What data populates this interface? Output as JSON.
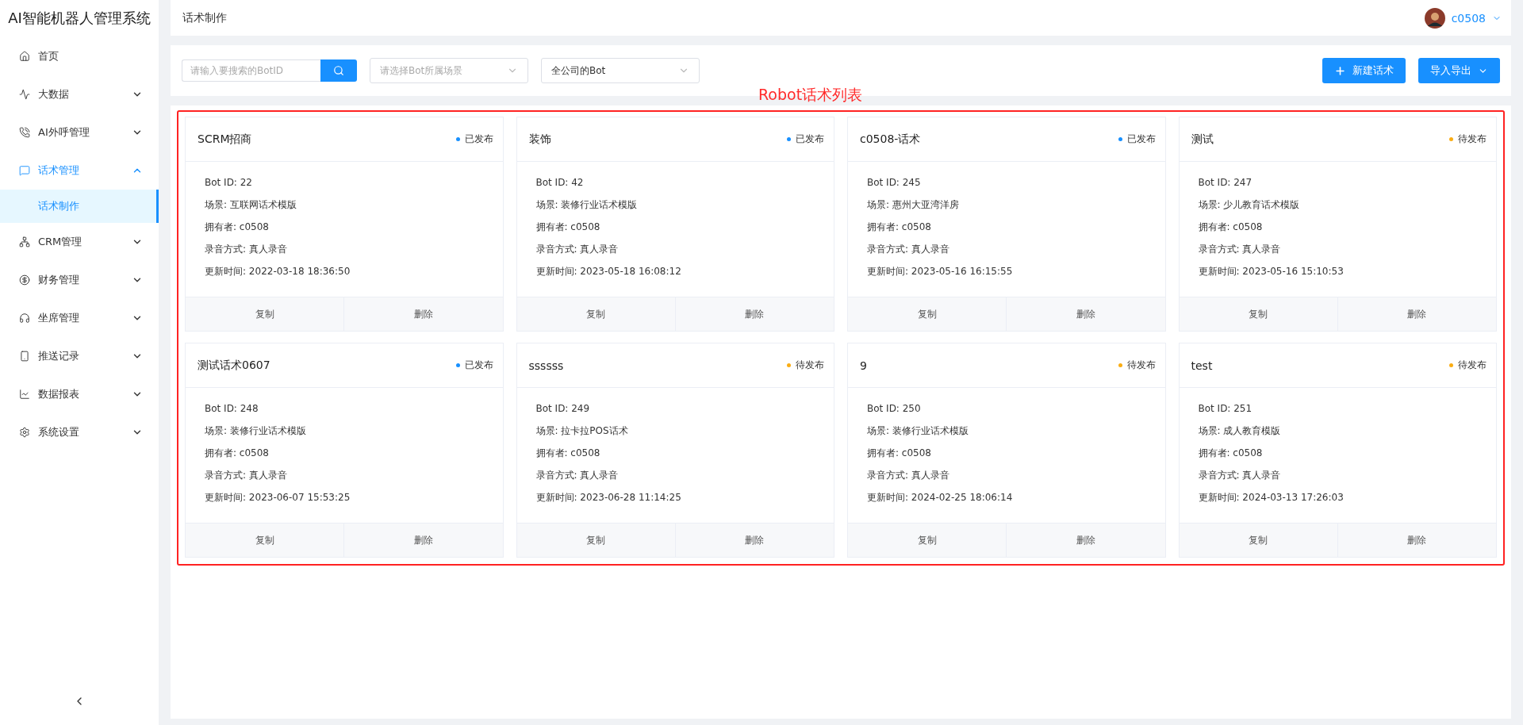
{
  "sidebar": {
    "title": "AI智能机器人管理系统",
    "items": [
      {
        "label": "首页",
        "selected": false
      },
      {
        "label": "大数据",
        "expanded": false,
        "selected": false
      },
      {
        "label": "AI外呼管理",
        "expanded": false,
        "selected": false
      },
      {
        "label": "话术管理",
        "expanded": true,
        "selected": true,
        "children": [
          {
            "label": "话术制作",
            "selected": true
          }
        ]
      },
      {
        "label": "CRM管理",
        "expanded": false,
        "selected": false
      },
      {
        "label": "财务管理",
        "expanded": false,
        "selected": false
      },
      {
        "label": "坐席管理",
        "expanded": false,
        "selected": false
      },
      {
        "label": "推送记录",
        "expanded": false,
        "selected": false
      },
      {
        "label": "数据报表",
        "expanded": false,
        "selected": false
      },
      {
        "label": "系统设置",
        "expanded": false,
        "selected": false
      }
    ]
  },
  "header": {
    "breadcrumb": "话术制作",
    "user": "c0508"
  },
  "toolbar": {
    "search": {
      "placeholder": "请输入要搜索的BotID"
    },
    "scene_select": {
      "placeholder": "请选择Bot所属场景"
    },
    "scope_select": {
      "value": "全公司的Bot"
    },
    "buttons": [
      {
        "label": "新建话术",
        "kind": "add"
      },
      {
        "label": "导入导出",
        "kind": "dropdown"
      }
    ]
  },
  "annotation": "Robot话术列表",
  "cards": [
    {
      "title": "SCRM招商",
      "status": "已发布",
      "color": "#1890ff",
      "lines": [
        "Bot ID: 22",
        "场景: 互联网话术模版",
        "拥有者: c0508",
        "录音方式: 真人录音",
        "更新时间: 2022-03-18 18:36:50"
      ],
      "actions": [
        "复制",
        "删除"
      ]
    },
    {
      "title": "装饰",
      "status": "已发布",
      "color": "#1890ff",
      "lines": [
        "Bot ID: 42",
        "场景: 装修行业话术模版",
        "拥有者: c0508",
        "录音方式: 真人录音",
        "更新时间: 2023-05-18 16:08:12"
      ],
      "actions": [
        "复制",
        "删除"
      ]
    },
    {
      "title": "c0508-话术",
      "status": "已发布",
      "color": "#1890ff",
      "lines": [
        "Bot ID: 245",
        "场景: 惠州大亚湾洋房",
        "拥有者: c0508",
        "录音方式: 真人录音",
        "更新时间: 2023-05-16 16:15:55"
      ],
      "actions": [
        "复制",
        "删除"
      ]
    },
    {
      "title": "测试",
      "status": "待发布",
      "color": "#faad14",
      "lines": [
        "Bot ID: 247",
        "场景: 少儿教育话术模版",
        "拥有者: c0508",
        "录音方式: 真人录音",
        "更新时间: 2023-05-16 15:10:53"
      ],
      "actions": [
        "复制",
        "删除"
      ]
    },
    {
      "title": "测试话术0607",
      "status": "已发布",
      "color": "#1890ff",
      "lines": [
        "Bot ID: 248",
        "场景: 装修行业话术模版",
        "拥有者: c0508",
        "录音方式: 真人录音",
        "更新时间: 2023-06-07 15:53:25"
      ],
      "actions": [
        "复制",
        "删除"
      ]
    },
    {
      "title": "ssssss",
      "status": "待发布",
      "color": "#faad14",
      "lines": [
        "Bot ID: 249",
        "场景: 拉卡拉POS话术",
        "拥有者: c0508",
        "录音方式: 真人录音",
        "更新时间: 2023-06-28 11:14:25"
      ],
      "actions": [
        "复制",
        "删除"
      ]
    },
    {
      "title": "9",
      "status": "待发布",
      "color": "#faad14",
      "lines": [
        "Bot ID: 250",
        "场景: 装修行业话术模版",
        "拥有者: c0508",
        "录音方式: 真人录音",
        "更新时间: 2024-02-25 18:06:14"
      ],
      "actions": [
        "复制",
        "删除"
      ]
    },
    {
      "title": "test",
      "status": "待发布",
      "color": "#faad14",
      "lines": [
        "Bot ID: 251",
        "场景: 成人教育模版",
        "拥有者: c0508",
        "录音方式: 真人录音",
        "更新时间: 2024-03-13 17:26:03"
      ],
      "actions": [
        "复制",
        "删除"
      ]
    }
  ]
}
